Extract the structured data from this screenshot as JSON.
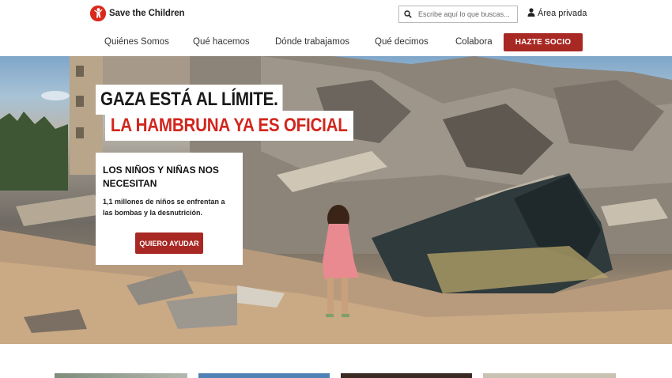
{
  "brand": {
    "name": "Save the Children",
    "primary_red": "#da291c",
    "button_red": "#a82823"
  },
  "header": {
    "search_placeholder": "Escribe aquí lo que buscas...",
    "private_area": "Área privada"
  },
  "nav": {
    "items": [
      "Quiénes Somos",
      "Qué hacemos",
      "Dónde trabajamos",
      "Qué decimos",
      "Colabora"
    ],
    "cta": "HAZTE SOCIO"
  },
  "hero": {
    "headline_1": "GAZA ESTÁ AL LÍMITE.",
    "headline_2": "LA HAMBRUNA YA ES OFICIAL",
    "card": {
      "title": "LOS NIÑOS Y NIÑAS NOS NECESITAN",
      "text": "1,1 millones de niños se enfrentan a las bombas y la desnutrición.",
      "button": "QUIERO AYUDAR"
    }
  }
}
